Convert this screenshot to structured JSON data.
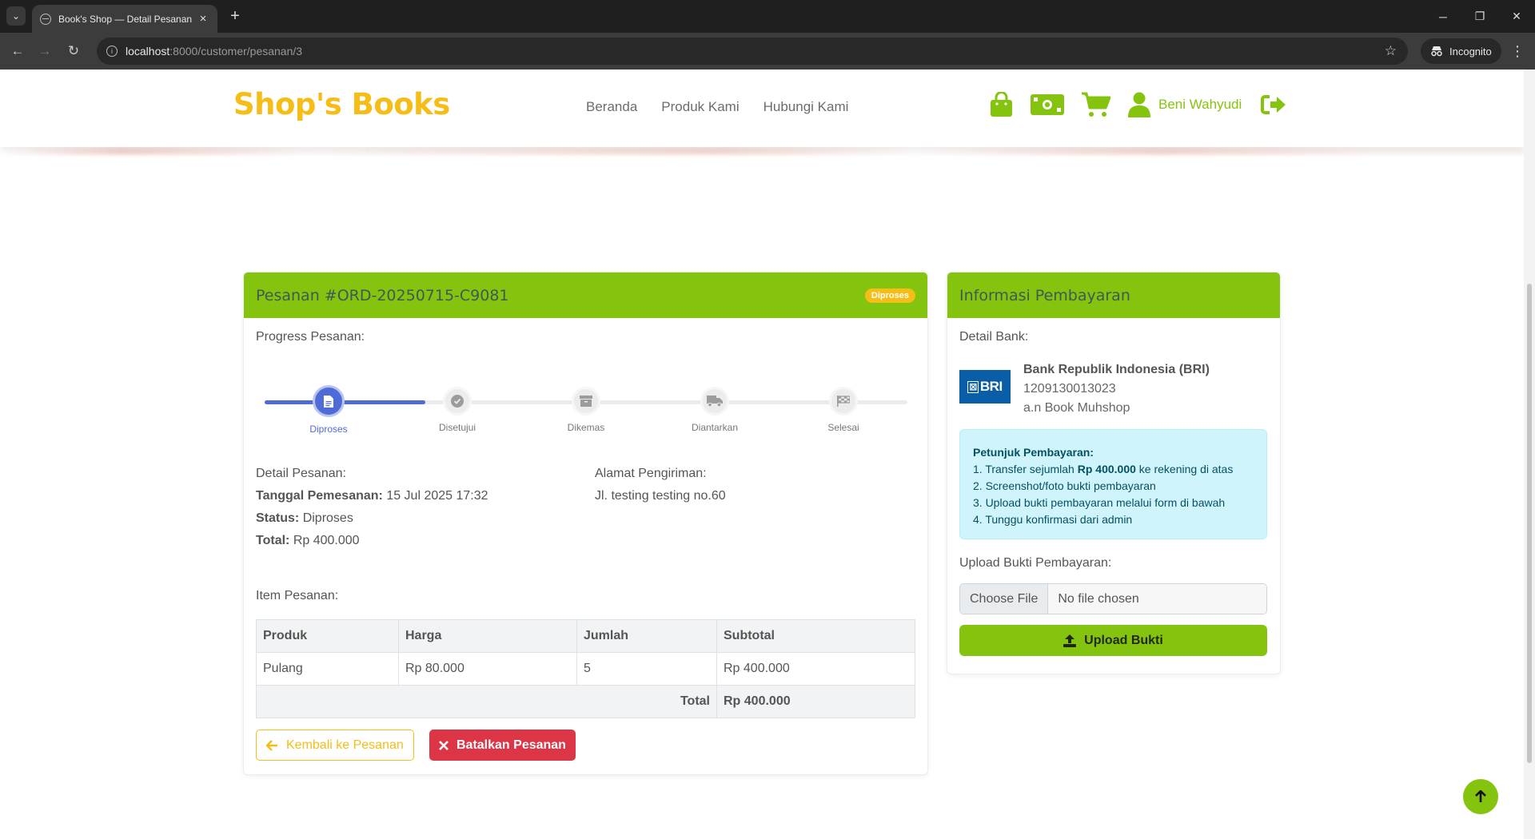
{
  "browser": {
    "tab_title": "Book's Shop — Detail Pesanan",
    "url_host": "localhost",
    "url_rest": ":8000/customer/pesanan/3",
    "incognito_label": "Incognito"
  },
  "header": {
    "brand": "Shop's Books",
    "nav": [
      "Beranda",
      "Produk Kami",
      "Hubungi Kami"
    ],
    "username": "Beni Wahyudi",
    "icons": [
      "shopping-bag-icon",
      "money-icon",
      "cart-icon",
      "user-icon",
      "logout-icon"
    ]
  },
  "order": {
    "title": "Pesanan #ORD-20250715-C9081",
    "badge": "Diproses",
    "progress_label": "Progress Pesanan:",
    "steps": [
      {
        "label": "Diproses",
        "icon": "document-icon",
        "active": true
      },
      {
        "label": "Disetujui",
        "icon": "check-circle-icon",
        "active": false
      },
      {
        "label": "Dikemas",
        "icon": "box-icon",
        "active": false
      },
      {
        "label": "Diantarkan",
        "icon": "truck-icon",
        "active": false
      },
      {
        "label": "Selesai",
        "icon": "flag-icon",
        "active": false
      }
    ],
    "detail_heading": "Detail Pesanan:",
    "date_label": "Tanggal Pemesanan:",
    "date_value": "15 Jul 2025 17:32",
    "status_label": "Status:",
    "status_value": "Diproses",
    "total_label": "Total:",
    "total_value": "Rp 400.000",
    "address_heading": "Alamat Pengiriman:",
    "address": "Jl. testing testing no.60",
    "items_heading": "Item Pesanan:",
    "table": {
      "headers": [
        "Produk",
        "Harga",
        "Jumlah",
        "Subtotal"
      ],
      "rows": [
        [
          "Pulang",
          "Rp 80.000",
          "5",
          "Rp 400.000"
        ]
      ],
      "total_label": "Total",
      "total_value": "Rp 400.000"
    },
    "back_button": "Kembali ke Pesanan",
    "cancel_button": "Batalkan Pesanan"
  },
  "payment": {
    "title": "Informasi Pembayaran",
    "bank_heading": "Detail Bank:",
    "bank_logo_text": "BRI",
    "bank_name": "Bank Republik Indonesia (BRI)",
    "account_number": "1209130013023",
    "account_holder": "a.n Book Muhshop",
    "instructions_title": "Petunjuk Pembayaran:",
    "instruction_1_prefix": "1. Transfer sejumlah ",
    "instruction_1_amount": "Rp 400.000",
    "instruction_1_suffix": " ke rekening di atas",
    "instruction_2": "2. Screenshot/foto bukti pembayaran",
    "instruction_3": "3. Upload bukti pembayaran melalui form di bawah",
    "instruction_4": "4. Tunggu konfirmasi dari admin",
    "upload_heading": "Upload Bukti Pembayaran:",
    "choose_file": "Choose File",
    "no_file": "No file chosen",
    "upload_button": "Upload Bukti"
  },
  "colors": {
    "brand_yellow": "#f5bd15",
    "accent_green": "#85c40e",
    "progress_blue": "#4f6bd8",
    "danger_red": "#dc3545"
  }
}
